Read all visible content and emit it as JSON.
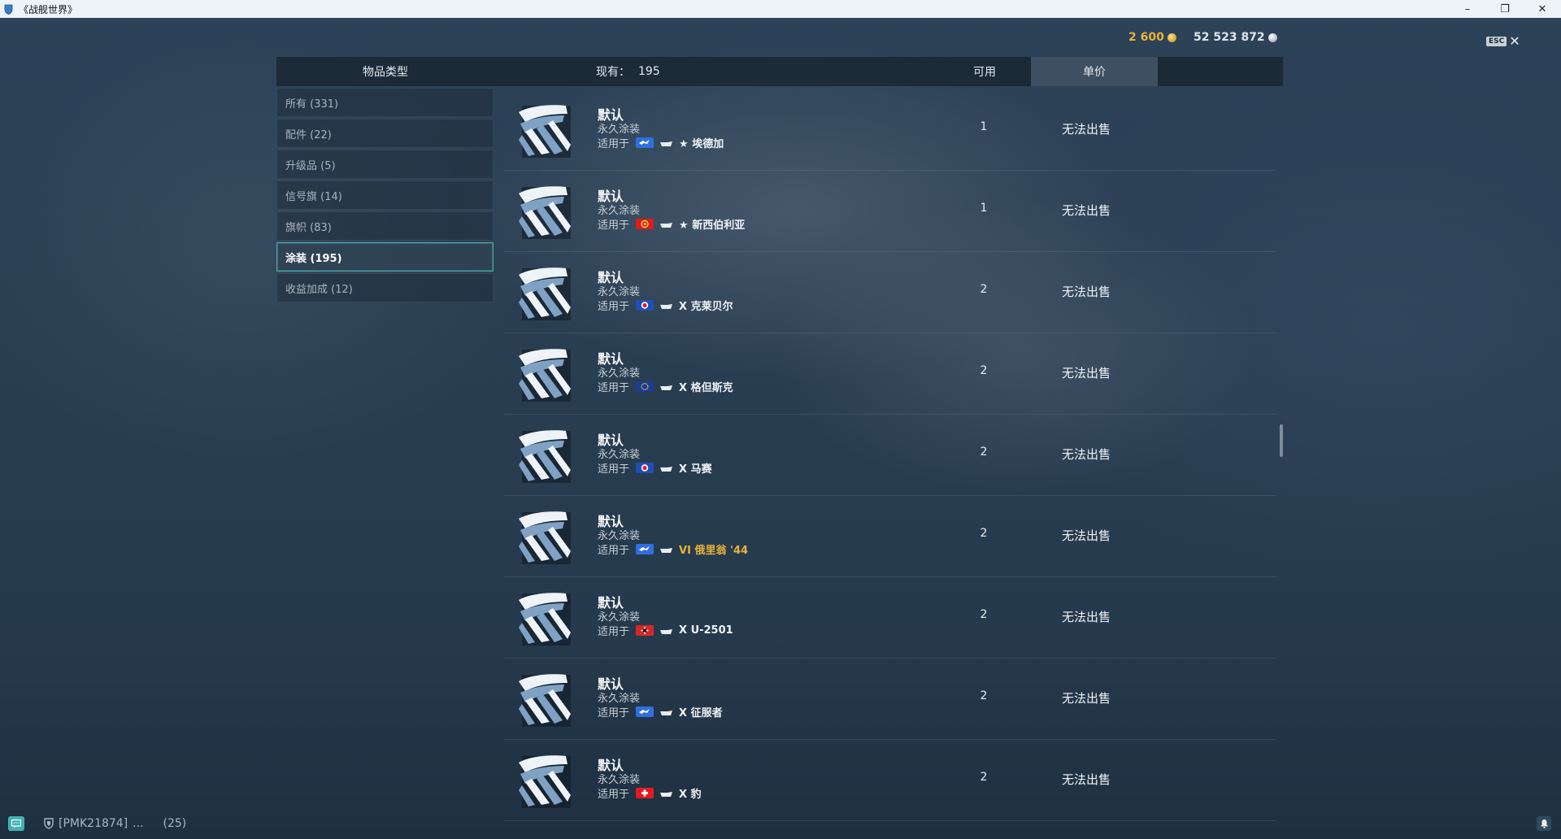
{
  "window": {
    "title": "《战舰世界》",
    "minimize": "–",
    "restore": "❐",
    "close": "✕"
  },
  "currency": {
    "gold": "2 600",
    "silver": "52 523 872"
  },
  "esc": {
    "key": "ESC",
    "close": "✕"
  },
  "header": {
    "type": "物品类型",
    "owned_label": "现有：",
    "owned_value": "195",
    "available": "可用",
    "price": "单价"
  },
  "categories": [
    {
      "label": "所有 (331)"
    },
    {
      "label": "配件 (22)"
    },
    {
      "label": "升级品 (5)"
    },
    {
      "label": "信号旗 (14)"
    },
    {
      "label": "旗帜 (83)"
    },
    {
      "label": "涂装 (195)",
      "active": true
    },
    {
      "label": "收益加成 (12)"
    }
  ],
  "rows": [
    {
      "name": "默认",
      "sub": "永久涂装",
      "apply": "适用于",
      "flag": "uk",
      "ship": "★ 埃德加",
      "available": "1",
      "price": "无法出售"
    },
    {
      "name": "默认",
      "sub": "永久涂装",
      "apply": "适用于",
      "flag": "pan-asia",
      "ship": "★ 新西伯利亚",
      "available": "1",
      "price": "无法出售"
    },
    {
      "name": "默认",
      "sub": "永久涂装",
      "apply": "适用于",
      "flag": "france",
      "ship": "X 克莱贝尔",
      "available": "2",
      "price": "无法出售"
    },
    {
      "name": "默认",
      "sub": "永久涂装",
      "apply": "适用于",
      "flag": "europe",
      "ship": "X 格但斯克",
      "available": "2",
      "price": "无法出售"
    },
    {
      "name": "默认",
      "sub": "永久涂装",
      "apply": "适用于",
      "flag": "france",
      "ship": "X 马赛",
      "available": "2",
      "price": "无法出售"
    },
    {
      "name": "默认",
      "sub": "永久涂装",
      "apply": "适用于",
      "flag": "uk",
      "ship": "VI 俄里翁 '44",
      "available": "2",
      "price": "无法出售"
    },
    {
      "name": "默认",
      "sub": "永久涂装",
      "apply": "适用于",
      "flag": "germany",
      "ship": "X U-2501",
      "available": "2",
      "price": "无法出售"
    },
    {
      "name": "默认",
      "sub": "永久涂装",
      "apply": "适用于",
      "flag": "uk",
      "ship": "X 征服者",
      "available": "2",
      "price": "无法出售"
    },
    {
      "name": "默认",
      "sub": "永久涂装",
      "apply": "适用于",
      "flag": "swiss",
      "ship": "X 豹",
      "available": "2",
      "price": "无法出售"
    }
  ],
  "footer": {
    "clan": "[PMK21874]",
    "dots": "...",
    "count": "(25)"
  },
  "colors": {
    "accent": "#44b0b5",
    "gold": "#e8b33a",
    "active_border": "#4aa5a8"
  }
}
